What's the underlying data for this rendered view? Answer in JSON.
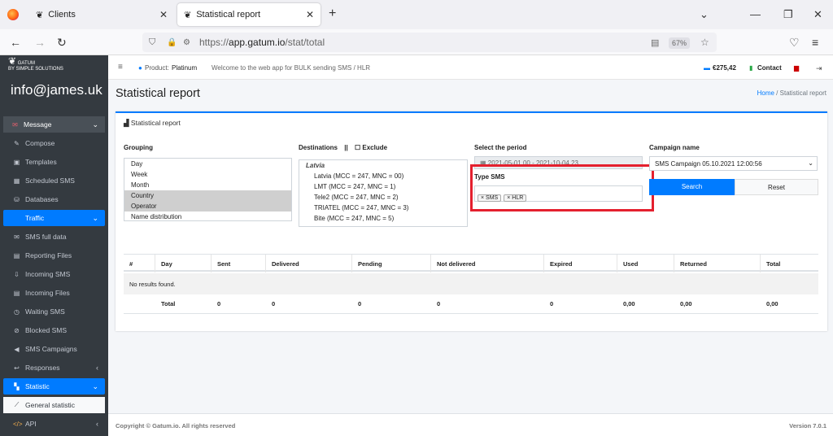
{
  "browser": {
    "tabs": [
      {
        "label": "Clients"
      },
      {
        "label": "Statistical report"
      }
    ],
    "url_host": "app.gatum.io",
    "url_path": "/stat/total",
    "url_scheme": "https://",
    "zoom": "67%"
  },
  "sidebar": {
    "account": "info@james.uk",
    "items": [
      {
        "label": "Message",
        "icon": "envelope-icon",
        "type": "group"
      },
      {
        "label": "Compose",
        "icon": "compose-icon"
      },
      {
        "label": "Templates",
        "icon": "template-icon"
      },
      {
        "label": "Scheduled SMS",
        "icon": "calendar-icon"
      },
      {
        "label": "Databases",
        "icon": "database-icon"
      },
      {
        "label": "Traffic",
        "icon": "",
        "type": "selected"
      },
      {
        "label": "SMS full data",
        "icon": "sms-icon"
      },
      {
        "label": "Reporting Files",
        "icon": "file-icon"
      },
      {
        "label": "Incoming SMS",
        "icon": "inbox-icon"
      },
      {
        "label": "Incoming Files",
        "icon": "file-icon"
      },
      {
        "label": "Waiting SMS",
        "icon": "clock-icon"
      },
      {
        "label": "Blocked SMS",
        "icon": "ban-icon"
      },
      {
        "label": "SMS Campaigns",
        "icon": "bullhorn-icon"
      },
      {
        "label": "Responses",
        "icon": "reply-icon"
      },
      {
        "label": "Statistic",
        "icon": "chart-icon",
        "type": "selected"
      },
      {
        "label": "General statistic",
        "icon": "line-chart-icon",
        "type": "sub"
      },
      {
        "label": "API",
        "icon": "code-icon"
      }
    ]
  },
  "topnav": {
    "product_label": "Product:",
    "product_value": "Platinum",
    "welcome": "Welcome to the web app for BULK sending SMS / HLR",
    "balance": "€275,42",
    "contact": "Contact"
  },
  "page": {
    "title": "Statistical report",
    "breadcrumb_home": "Home",
    "breadcrumb_sep": "/",
    "breadcrumb_current": "Statistical report",
    "card_title": "Statistical report"
  },
  "filters": {
    "grouping_label": "Grouping",
    "grouping_options": [
      {
        "label": "Day",
        "selected": false
      },
      {
        "label": "Week",
        "selected": false
      },
      {
        "label": "Month",
        "selected": false
      },
      {
        "label": "Country",
        "selected": true
      },
      {
        "label": "Operator",
        "selected": true
      },
      {
        "label": "Name distribution",
        "selected": false
      }
    ],
    "destinations_label": "Destinations",
    "exclude_label": "Exclude",
    "destinations_group": "Latvia",
    "destinations": [
      "Latvia (MCC = 247, MNC = 00)",
      "LMT (MCC = 247, MNC = 1)",
      "Tele2 (MCC = 247, MNC = 2)",
      "TRIATEL (MCC = 247, MNC = 3)",
      "Bite (MCC = 247, MNC = 5)"
    ],
    "period_label": "Select the period",
    "period_value": "2021-05-01 00 - 2021-10-04 23",
    "type_label": "Type SMS",
    "type_tags": [
      "SMS",
      "HLR"
    ],
    "campaign_label": "Campaign name",
    "campaign_value": "SMS Campaign 05.10.2021 12:00:56",
    "search_label": "Search",
    "reset_label": "Reset"
  },
  "table": {
    "columns": [
      "#",
      "Day",
      "Sent",
      "Delivered",
      "Pending",
      "Not delivered",
      "Expired",
      "Used",
      "Returned",
      "Total"
    ],
    "empty_text": "No results found.",
    "totals": [
      "",
      "Total",
      "0",
      "0",
      "0",
      "0",
      "0",
      "0,00",
      "0,00",
      "0,00"
    ]
  },
  "footer": {
    "copyright": "Copyright © Gatum.io. All rights reserved",
    "version": "Version 7.0.1"
  }
}
